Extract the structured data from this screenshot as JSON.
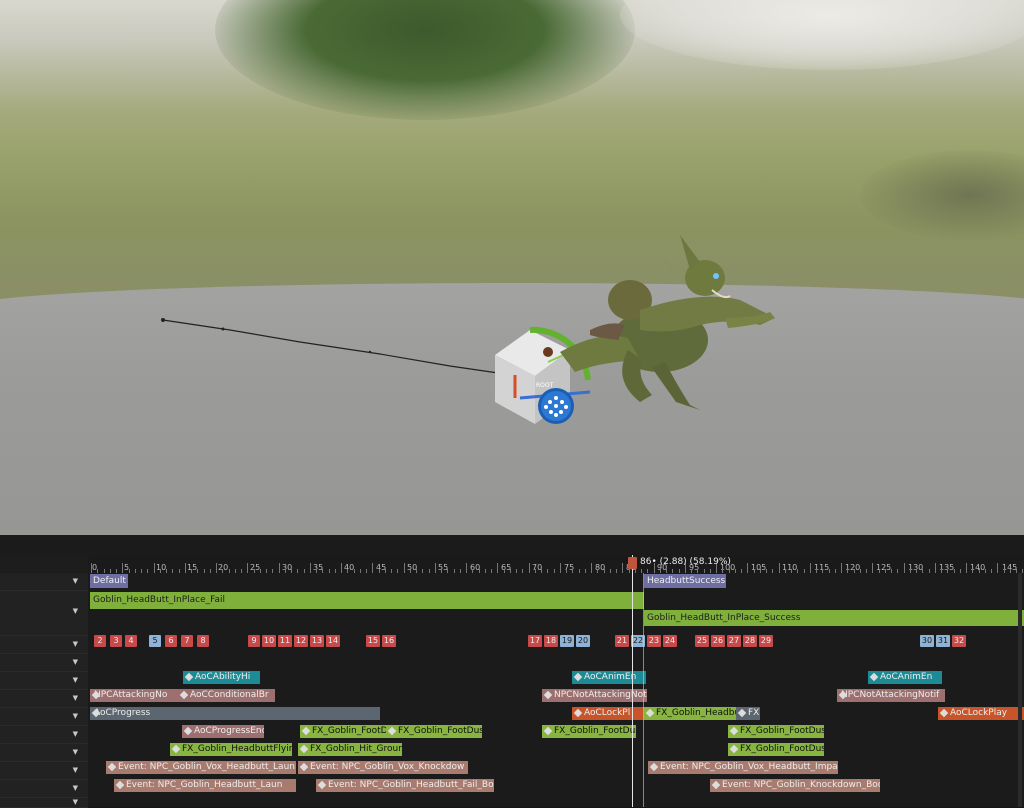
{
  "timeline": {
    "current_frame": "86",
    "playhead_label": "86• (2.88) (58.19%)",
    "ruler_ticks": [
      "0",
      "5",
      "10",
      "15",
      "20",
      "25",
      "30",
      "35",
      "40",
      "45",
      "50",
      "55",
      "60",
      "65",
      "70",
      "75",
      "80",
      "85",
      "90",
      "95",
      "100",
      "105",
      "110",
      "115",
      "120",
      "125",
      "130",
      "135",
      "140",
      "145"
    ],
    "row_count": 13,
    "sections": {
      "default_label": "Default",
      "success_label": "HeadbuttSuccess",
      "fail_clip": "Goblin_HeadButt_InPlace_Fail",
      "success_clip": "Goblin_HeadButt_InPlace_Success"
    },
    "frame_markers": [
      "2",
      "3",
      "4",
      "5",
      "6",
      "7",
      "8",
      "9",
      "10",
      "11",
      "12",
      "13",
      "14",
      "15",
      "16",
      "17",
      "18",
      "19",
      "20",
      "21",
      "22",
      "23",
      "24",
      "25",
      "26",
      "27",
      "28",
      "29",
      "30",
      "31",
      "32"
    ],
    "notifies": {
      "row4": [
        "AoCAbilityHi",
        "AoCAnimEn",
        "AoCAnimEn"
      ],
      "row5": [
        "NPCAttackingNo",
        "AoCConditionalBr",
        "NPCNotAttackingNotif",
        "NPCNotAttackingNotif"
      ],
      "row6": [
        "AoCProgress",
        "AoCLockPl",
        "FX_Goblin_Headbu",
        "FX",
        "AoCLockPlay"
      ],
      "row7": [
        "AoCProgressEnd",
        "FX_Goblin_FootD",
        "FX_Goblin_FootDus",
        "FX_Goblin_FootDus",
        "FX_Goblin_FootDus"
      ],
      "row8": [
        "FX_Goblin_HeadbuttFlyin",
        "FX_Goblin_Hit_Groun",
        "FX_Goblin_FootDus"
      ],
      "row9": [
        "Event: NPC_Goblin_Vox_Headbutt_Laun",
        "Event: NPC_Goblin_Vox_Knockdow",
        "Event: NPC_Goblin_Vox_Headbutt_Impa"
      ],
      "row10": [
        "Event: NPC_Goblin_Headbutt_Laun",
        "Event: NPC_Goblin_Headbutt_Fail_Bo",
        "Event: NPC_Goblin_Knockdown_Boo"
      ]
    }
  },
  "viewport": {
    "gizmo_label": "ROOT"
  }
}
